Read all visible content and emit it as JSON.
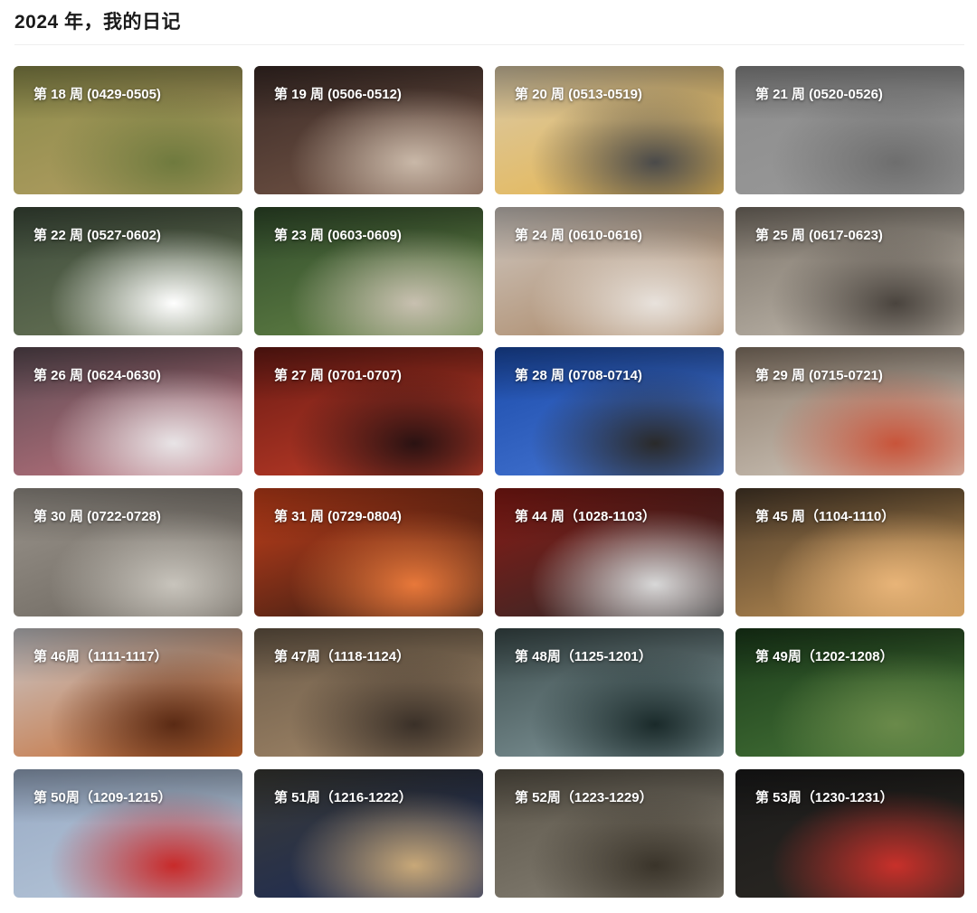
{
  "page": {
    "title": "2024 年，我的日记"
  },
  "cards": [
    {
      "label": "第 18 周 (0429-0505)",
      "image": "child-waving-photo",
      "colors": [
        "#8a8a4a",
        "#b6a064",
        "#6f7a3e"
      ]
    },
    {
      "label": "第 19 周 (0506-0512)",
      "image": "child-jumping-photo",
      "colors": [
        "#3a2a26",
        "#7a5a4a",
        "#c9b8a8"
      ]
    },
    {
      "label": "第 20 周 (0513-0519)",
      "image": "cafe-walkway-photo",
      "colors": [
        "#d9c9a8",
        "#e8b548",
        "#4a4a4a"
      ]
    },
    {
      "label": "第 21 周 (0520-0526)",
      "image": "foggy-lamp-photo",
      "colors": [
        "#8c8c8c",
        "#9a9a9a",
        "#6e6e6e"
      ]
    },
    {
      "label": "第 22 周 (0527-0602)",
      "image": "dragon-kite-photo",
      "colors": [
        "#3c4a3a",
        "#6e7a5a",
        "#ffffff"
      ]
    },
    {
      "label": "第 23 周 (0603-0609)",
      "image": "child-in-forest-photo",
      "colors": [
        "#2f4a2a",
        "#6a8a4a",
        "#c8c0b0"
      ]
    },
    {
      "label": "第 24 周 (0610-0616)",
      "image": "baby-on-blanket-photo",
      "colors": [
        "#cfc8c2",
        "#a8825e",
        "#e8e2dc"
      ]
    },
    {
      "label": "第 25 周 (0617-0623)",
      "image": "mall-atrium-photo",
      "colors": [
        "#7a7268",
        "#c8c0b4",
        "#4a443e"
      ]
    },
    {
      "label": "第 26 周 (0624-0630)",
      "image": "lofoten-mountains-photo",
      "colors": [
        "#5a4a52",
        "#c87884",
        "#e8e4e6"
      ]
    },
    {
      "label": "第 27 周 (0701-0707)",
      "image": "red-sunset-sea-photo",
      "colors": [
        "#6a1a14",
        "#c8402a",
        "#2a1212"
      ]
    },
    {
      "label": "第 28 周 (0708-0714)",
      "image": "skyscrapers-sky-photo",
      "colors": [
        "#1a4aa8",
        "#4a7ad8",
        "#2a2a2a"
      ]
    },
    {
      "label": "第 29 周 (0715-0721)",
      "image": "kids-sleeping-photo",
      "colors": [
        "#8a7a6a",
        "#d8cfc4",
        "#c8543a"
      ]
    },
    {
      "label": "第 30 周 (0722-0728)",
      "image": "dolomites-chapel-photo",
      "colors": [
        "#9a948c",
        "#6a645c",
        "#c8c4bc"
      ]
    },
    {
      "label": "第 31 周 (0729-0804)",
      "image": "torii-tunnel-photo",
      "colors": [
        "#c8401a",
        "#2a1a14",
        "#e8783a"
      ]
    },
    {
      "label": "第 44 周（1028-1103）",
      "image": "subway-escalator-photo",
      "colors": [
        "#8a1a14",
        "#2a2a2a",
        "#d8d8d8"
      ]
    },
    {
      "label": "第 45 周（1104-1110）",
      "image": "beach-sand-photo",
      "colors": [
        "#4a3a2a",
        "#c89858",
        "#e8b478"
      ]
    },
    {
      "label": "第 46周（1111-1117）",
      "image": "red-dune-photo",
      "colors": [
        "#c8c8cc",
        "#c8682a",
        "#5a2a14"
      ]
    },
    {
      "label": "第 47周（1118-1124）",
      "image": "motorcycles-dirt-photo",
      "colors": [
        "#6a5a48",
        "#a88c6c",
        "#3a3028"
      ]
    },
    {
      "label": "第 48周（1125-1201）",
      "image": "waterfall-cliff-photo",
      "colors": [
        "#3a4a4a",
        "#8aa0a4",
        "#1a2a2a"
      ]
    },
    {
      "label": "第 49周（1202-1208）",
      "image": "forest-tree-photo",
      "colors": [
        "#1a3a1a",
        "#4a7a3a",
        "#6a8a4a"
      ]
    },
    {
      "label": "第 50周（1209-1215）",
      "image": "airshow-jets-photo",
      "colors": [
        "#98aac4",
        "#b8c8da",
        "#c82a2a"
      ]
    },
    {
      "label": "第 51周（1216-1222）",
      "image": "woman-with-notebook-photo",
      "colors": [
        "#3a3a34",
        "#1a2a5a",
        "#c8a878"
      ]
    },
    {
      "label": "第 52周（1223-1229）",
      "image": "vintage-car-photo",
      "colors": [
        "#5a5448",
        "#8a8478",
        "#3a342a"
      ]
    },
    {
      "label": "第 53周（1230-1231）",
      "image": "dog-in-red-coat-photo",
      "colors": [
        "#1a1a1a",
        "#2e2a24",
        "#c8302a"
      ]
    }
  ]
}
